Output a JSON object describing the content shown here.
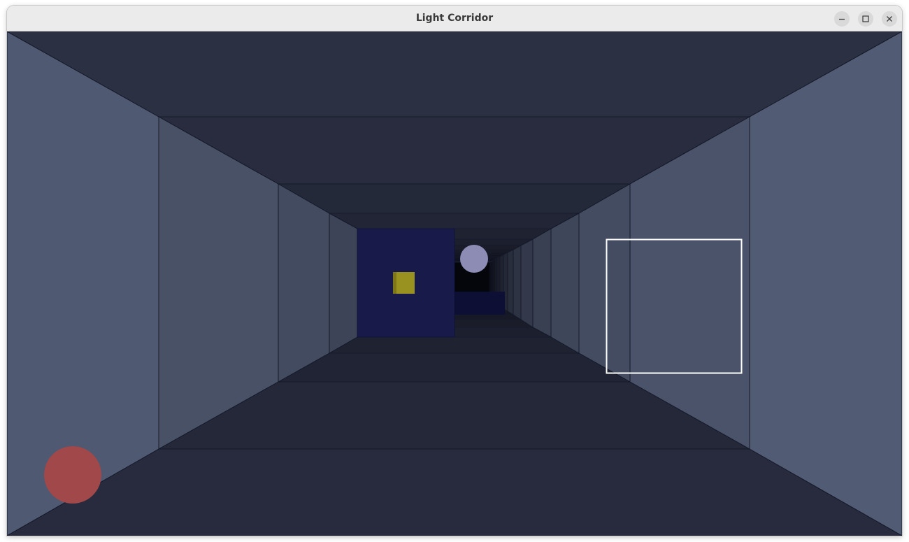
{
  "window": {
    "title": "Light Corridor"
  },
  "titlebar_buttons": [
    {
      "name": "minimize-button",
      "icon": "minimize-icon"
    },
    {
      "name": "maximize-button",
      "icon": "maximize-icon"
    },
    {
      "name": "close-button",
      "icon": "close-icon"
    }
  ],
  "scene": {
    "description_type": "3d-corridor",
    "colors": {
      "ceiling": "#2b3043",
      "floor": "#272b3d",
      "wall": "#515b73",
      "edge": "#151a2a",
      "far_end": "#05050c",
      "obstacle": "#181a4a",
      "ball": "#8c8cb4",
      "yellow_cube": "#9a9220",
      "racket_outline": "#ffffff",
      "life_indicator": "#a0484a"
    }
  }
}
